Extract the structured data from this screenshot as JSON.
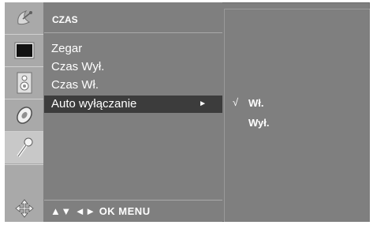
{
  "menu": {
    "title": "CZAS",
    "items": [
      {
        "label": "Zegar"
      },
      {
        "label": "Czas Wył."
      },
      {
        "label": "Czas Wł."
      },
      {
        "label": "Auto wyłączanie",
        "arrow": "►"
      }
    ],
    "nav_hint": "▲▼ ◄► OK MENU"
  },
  "submenu": {
    "check_mark": "√",
    "options": [
      {
        "label": "Wł."
      },
      {
        "label": "Wył."
      }
    ]
  },
  "sidebar": {
    "icons": [
      "satellite-dish-icon",
      "screen-icon",
      "speaker-icon",
      "disc-icon",
      "key-icon",
      "arrows-icon"
    ]
  },
  "colors": {
    "panel": "#7f7f7f",
    "strip": "#a9a9a9",
    "highlight": "#3c3c3c",
    "text": "#ffffff"
  }
}
